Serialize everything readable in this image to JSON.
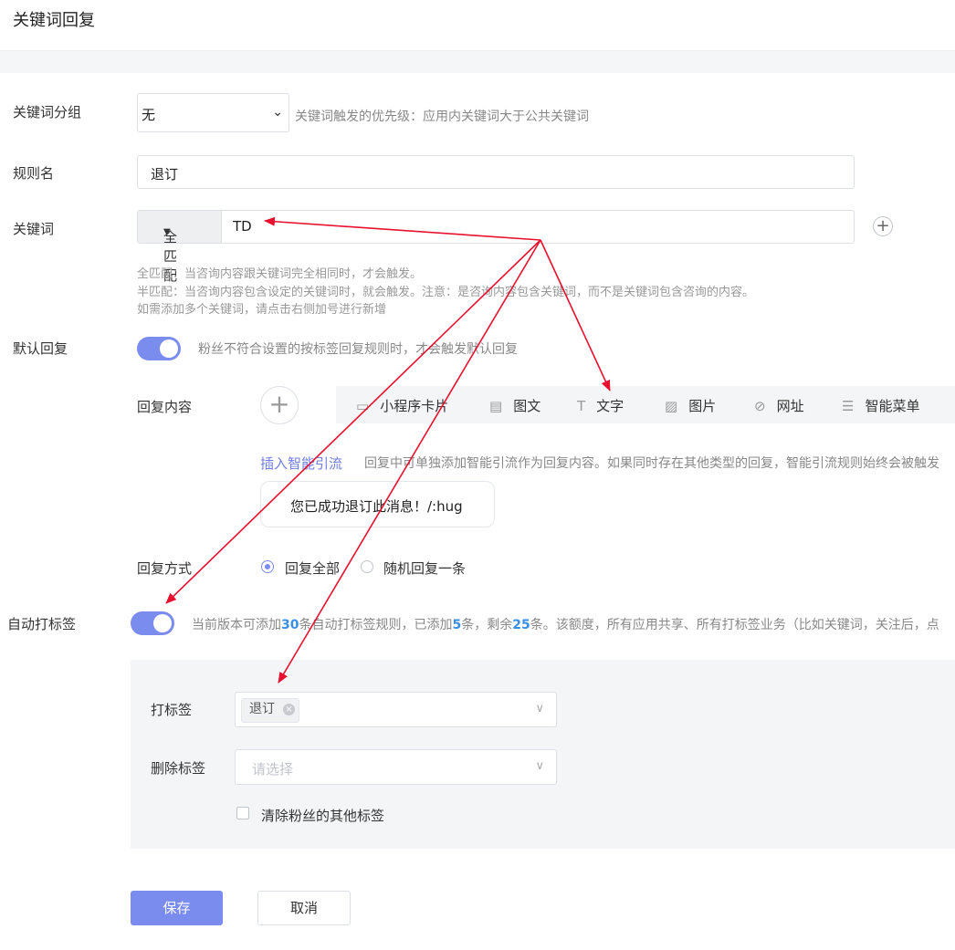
{
  "page_title": "关键词回复",
  "group": {
    "label": "关键词分组",
    "value": "无",
    "hint": "关键词触发的优先级：应用内关键词大于公共关键词"
  },
  "rule": {
    "label": "规则名",
    "value": "退订"
  },
  "keyword": {
    "label": "关键词",
    "mode": "全匹配",
    "value": "TD",
    "help": [
      "全匹配：当咨询内容跟关键词完全相同时，才会触发。",
      "半匹配：当咨询内容包含设定的关键词时，就会触发。注意：是咨询内容包含关键词，而不是关键词包含咨询的内容。",
      "如需添加多个关键词，请点击右侧加号进行新增"
    ]
  },
  "default_reply": {
    "label": "默认回复",
    "enabled": true,
    "hint": "粉丝不符合设置的按标签回复规则时，才会触发默认回复"
  },
  "reply_content": {
    "label": "回复内容",
    "types": [
      {
        "icon": "mini-program-card-icon",
        "label": "小程序卡片"
      },
      {
        "icon": "image-text-icon",
        "label": "图文"
      },
      {
        "icon": "text-icon",
        "label": "文字"
      },
      {
        "icon": "picture-icon",
        "label": "图片"
      },
      {
        "icon": "link-icon",
        "label": "网址"
      },
      {
        "icon": "menu-list-icon",
        "label": "智能菜单"
      }
    ],
    "smart_link": "插入智能引流",
    "smart_hint": "回复中可单独添加智能引流作为回复内容。如果同时存在其他类型的回复，智能引流规则始终会被触发",
    "message": "您已成功退订此消息！/:hug"
  },
  "reply_mode": {
    "label": "回复方式",
    "options": [
      "回复全部",
      "随机回复一条"
    ],
    "selected": "回复全部"
  },
  "auto_tag": {
    "label": "自动打标签",
    "enabled": true,
    "hint_parts": [
      "当前版本可添加",
      "30",
      "条自动打标签规则，已添加",
      "5",
      "条，剩余",
      "25",
      "条。该额度，所有应用共享、所有打标签业务（比如关键词，关注后，点"
    ],
    "tag_label": "打标签",
    "tag_chip": "退订",
    "remove_label": "删除标签",
    "remove_placeholder": "请选择",
    "clear_label": "清除粉丝的其他标签"
  },
  "buttons": {
    "save": "保存",
    "cancel": "取消"
  },
  "colors": {
    "accent": "#7b8cef",
    "link": "#6f7ee6",
    "count": "#3a8ee6",
    "annotation_arrow": "#e8102e"
  }
}
